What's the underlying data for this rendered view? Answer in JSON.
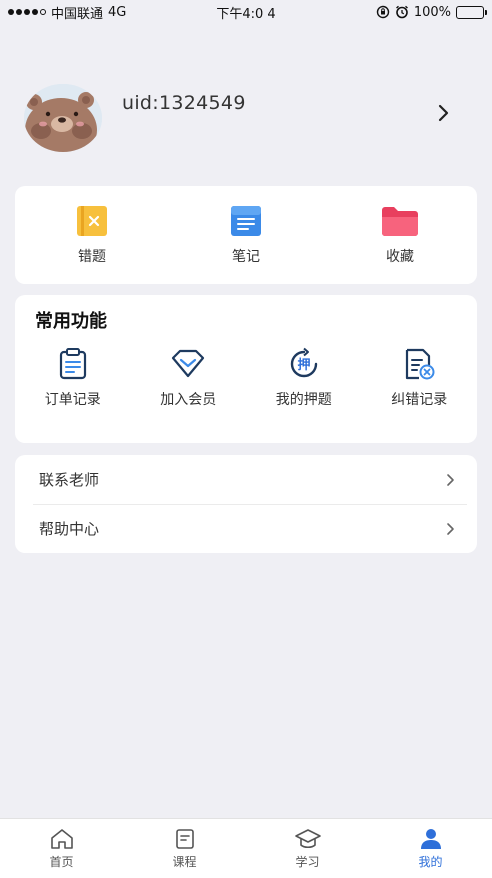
{
  "status_bar": {
    "carrier": "中国联通",
    "network": "4G",
    "time": "下午4:0 4",
    "battery": "100%"
  },
  "profile": {
    "uid": "uid:1324549"
  },
  "top_items": [
    {
      "label": "错题",
      "icon": "wrong-question-icon",
      "color": "#f5b731"
    },
    {
      "label": "笔记",
      "icon": "notes-icon",
      "color": "#3b8ae8"
    },
    {
      "label": "收藏",
      "icon": "favorites-folder-icon",
      "color": "#f0506e"
    }
  ],
  "common": {
    "title": "常用功能",
    "items": [
      {
        "label": "订单记录",
        "icon": "order-record-icon"
      },
      {
        "label": "加入会员",
        "icon": "membership-diamond-icon"
      },
      {
        "label": "我的押题",
        "icon": "my-predictions-icon",
        "glyph": "押"
      },
      {
        "label": "纠错记录",
        "icon": "error-correction-icon"
      }
    ]
  },
  "links": [
    {
      "label": "联系老师"
    },
    {
      "label": "帮助中心"
    }
  ],
  "tabs": [
    {
      "label": "首页",
      "icon": "home-icon"
    },
    {
      "label": "课程",
      "icon": "course-icon"
    },
    {
      "label": "学习",
      "icon": "study-cap-icon"
    },
    {
      "label": "我的",
      "icon": "profile-user-icon",
      "active": true
    }
  ],
  "colors": {
    "background": "#efeff4",
    "accent": "#2e6fd9",
    "icon_dark": "#1e3a5f"
  }
}
